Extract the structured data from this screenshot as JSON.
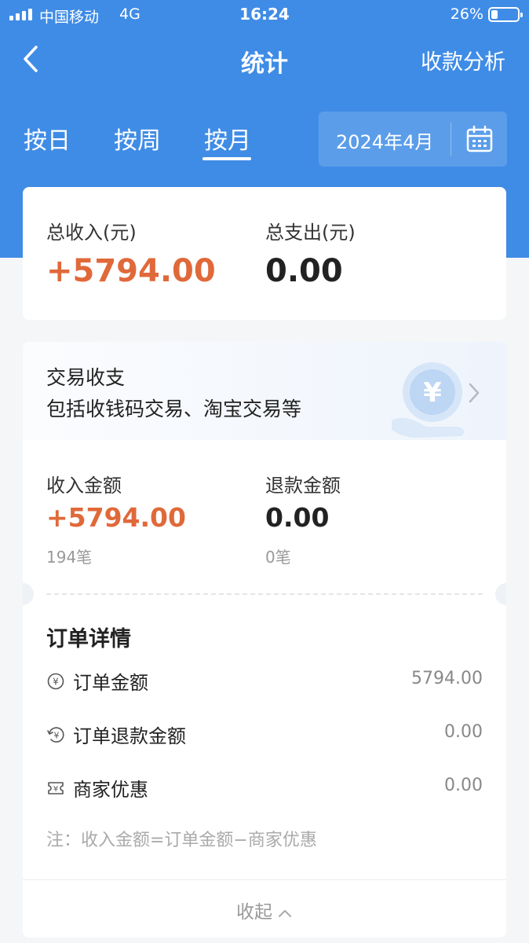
{
  "status_bar": {
    "carrier": "中国移动",
    "network": "4G",
    "time": "16:24",
    "battery": "26%",
    "battery_level": 0.26
  },
  "nav": {
    "title": "统计",
    "right_action": "收款分析",
    "back_icon": "back-arrow-icon"
  },
  "tabs": [
    {
      "label": "按日",
      "active": false
    },
    {
      "label": "按周",
      "active": false
    },
    {
      "label": "按月",
      "active": true
    }
  ],
  "date_picker": {
    "value": "2024年4月",
    "icon": "calendar-icon"
  },
  "summary": {
    "income_label": "总收入(元)",
    "income_value": "+5794.00",
    "expense_label": "总支出(元)",
    "expense_value": "0.00"
  },
  "transactions": {
    "title": "交易收支",
    "subtitle": "包括收钱码交易、淘宝交易等",
    "income_label": "收入金额",
    "income_value": "+5794.00",
    "income_count": "194笔",
    "refund_label": "退款金额",
    "refund_value": "0.00",
    "refund_count": "0笔"
  },
  "order_details": {
    "title": "订单详情",
    "rows": [
      {
        "icon": "yuan-coin-icon",
        "label": "订单金额",
        "value": "5794.00"
      },
      {
        "icon": "refund-icon",
        "label": "订单退款金额",
        "value": "0.00"
      },
      {
        "icon": "coupon-icon",
        "label": "商家优惠",
        "value": "0.00"
      }
    ],
    "note": "注：收入金额=订单金额−商家优惠"
  },
  "collapse_label": "收起",
  "colors": {
    "header": "#3f8ce6",
    "income": "#e0693a",
    "page_bg": "#f5f6f8"
  }
}
